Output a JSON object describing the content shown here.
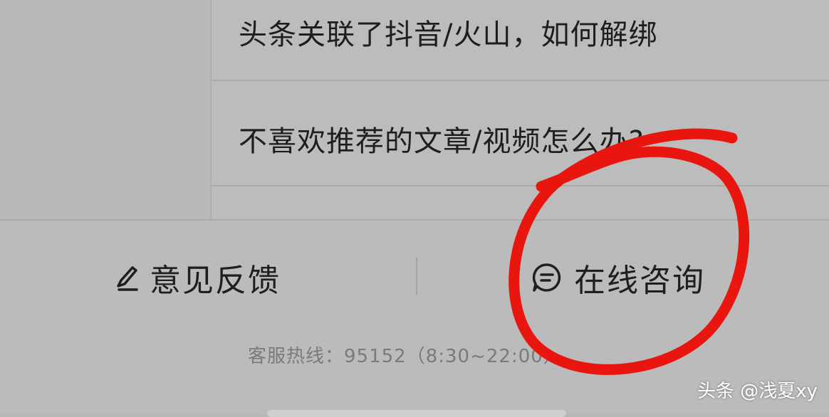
{
  "faq": {
    "items": [
      {
        "label": "头条关联了抖音/火山，如何解绑"
      },
      {
        "label": "不喜欢推荐的文章/视频怎么办?"
      }
    ]
  },
  "bottom": {
    "feedback": {
      "label": "意见反馈",
      "icon": "pencil-icon"
    },
    "consult": {
      "label": "在线咨询",
      "icon": "chat-bubble-icon"
    },
    "hotline": "客服热线：95152（8:30~22:00）"
  },
  "watermark": "头条 @浅夏xy",
  "annotation": {
    "type": "hand-drawn circle",
    "color": "#e8160f"
  },
  "colors": {
    "background": "#b8b8b8",
    "text": "#1f1f1f",
    "hint": "#7a7a7a"
  }
}
